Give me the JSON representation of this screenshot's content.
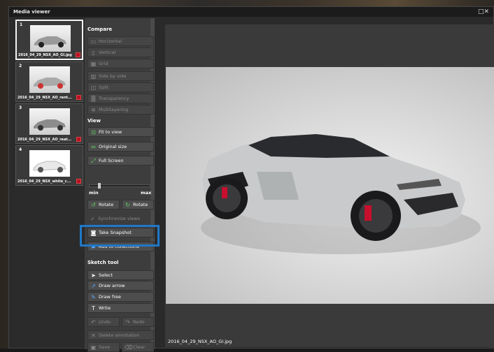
{
  "window": {
    "title": "Media viewer",
    "controls": "□✕"
  },
  "thumbnails": [
    {
      "num": "1",
      "label": "2016_04_29_NSX_AO_GI.jpg",
      "selected": true
    },
    {
      "num": "2",
      "label": "2016_04_29_NSX_AO_rent...",
      "selected": false
    },
    {
      "num": "3",
      "label": "2016_04_29_NSX_AO_reat...",
      "selected": false
    },
    {
      "num": "4",
      "label": "2016_04_29_NSX_white_c...",
      "selected": false
    }
  ],
  "panel": {
    "compare_header": "Compare",
    "horizontal": "Horizontal",
    "vertical": "Vertical",
    "grid": "Grid",
    "side_by_side": "Side by side",
    "split": "Split",
    "transparency": "Transparency",
    "multilayering": "Multilayering",
    "view_header": "View",
    "fit_to_view": "Fit to view",
    "original_size": "Original size",
    "full_screen": "Full Screen",
    "min": "min",
    "max": "max",
    "rotate_left": "Rotate",
    "rotate_right": "Rotate",
    "sync_views": "Synchronize views",
    "take_snapshot": "Take Snapshot",
    "add_to_collections": "Add to collections",
    "sketch_header": "Sketch tool",
    "select": "Select",
    "draw_arrow": "Draw arrow",
    "draw_free": "Draw free",
    "write": "Write",
    "undo": "Undo",
    "redo": "Redo",
    "delete_annotation": "Delete annotation",
    "save": "Save",
    "clear": "Clear"
  },
  "viewer": {
    "filename": "2016_04_29_NSX_AO_GI.jpg"
  },
  "colors": {
    "highlight": "#1f78c8"
  }
}
